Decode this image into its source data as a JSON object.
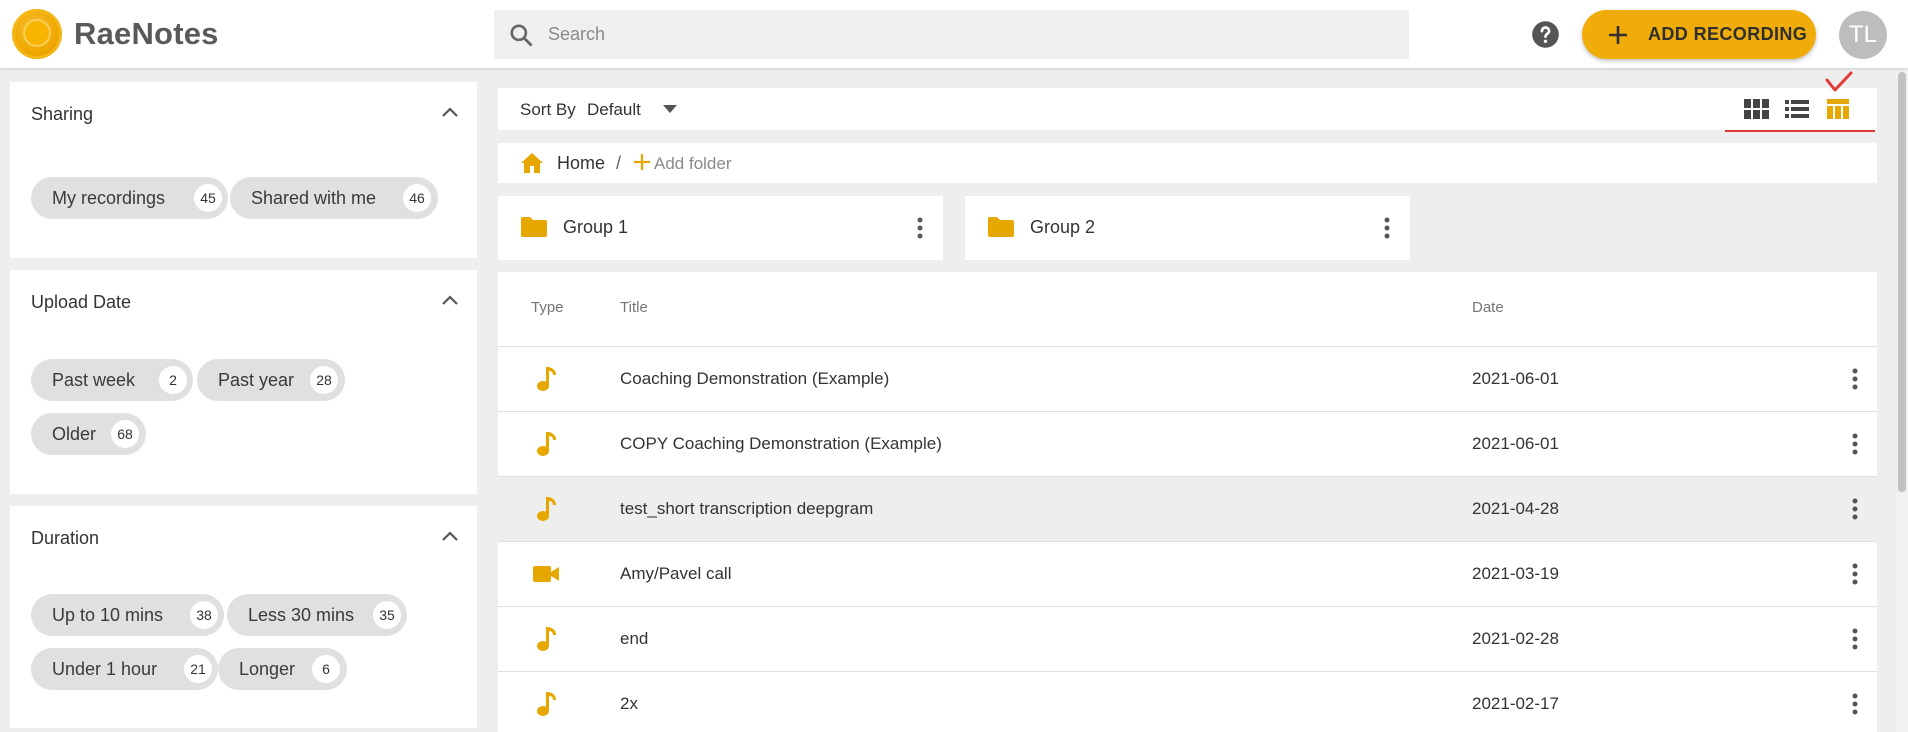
{
  "header": {
    "app_title": "RaeNotes",
    "search_placeholder": "Search",
    "add_recording_label": "ADD RECORDING",
    "avatar_initials": "TL"
  },
  "sidebar": {
    "sharing": {
      "title": "Sharing",
      "chips": [
        {
          "label": "My recordings",
          "count": "45"
        },
        {
          "label": "Shared with me",
          "count": "46"
        }
      ]
    },
    "upload_date": {
      "title": "Upload Date",
      "chips": [
        {
          "label": "Past week",
          "count": "2"
        },
        {
          "label": "Past year",
          "count": "28"
        },
        {
          "label": "Older",
          "count": "68"
        }
      ]
    },
    "duration": {
      "title": "Duration",
      "chips": [
        {
          "label": "Up to 10 mins",
          "count": "38"
        },
        {
          "label": "Less 30 mins",
          "count": "35"
        },
        {
          "label": "Under 1 hour",
          "count": "21"
        },
        {
          "label": "Longer",
          "count": "6"
        }
      ]
    }
  },
  "toolbar": {
    "sort_label": "Sort By",
    "sort_value": "Default",
    "views": [
      "grid-view-icon",
      "list-view-icon",
      "table-view-icon"
    ],
    "active_view": "table-view-icon"
  },
  "breadcrumb": {
    "home": "Home",
    "separator": "/",
    "add_folder": "Add folder"
  },
  "folders": [
    {
      "name": "Group 1"
    },
    {
      "name": "Group 2"
    }
  ],
  "table": {
    "columns": {
      "type": "Type",
      "title": "Title",
      "date": "Date"
    },
    "rows": [
      {
        "type": "audio",
        "title": "Coaching Demonstration (Example)",
        "date": "2021-06-01"
      },
      {
        "type": "audio",
        "title": "COPY Coaching Demonstration (Example)",
        "date": "2021-06-01"
      },
      {
        "type": "audio",
        "title": "test_short transcription deepgram",
        "date": "2021-04-28"
      },
      {
        "type": "video",
        "title": "Amy/Pavel call",
        "date": "2021-03-19"
      },
      {
        "type": "audio",
        "title": "end",
        "date": "2021-02-28"
      },
      {
        "type": "audio",
        "title": "2x",
        "date": "2021-02-17"
      }
    ]
  },
  "colors": {
    "accent": "#f0ad0a",
    "icon_gold": "#e6a800",
    "annotation_red": "#e53935"
  }
}
